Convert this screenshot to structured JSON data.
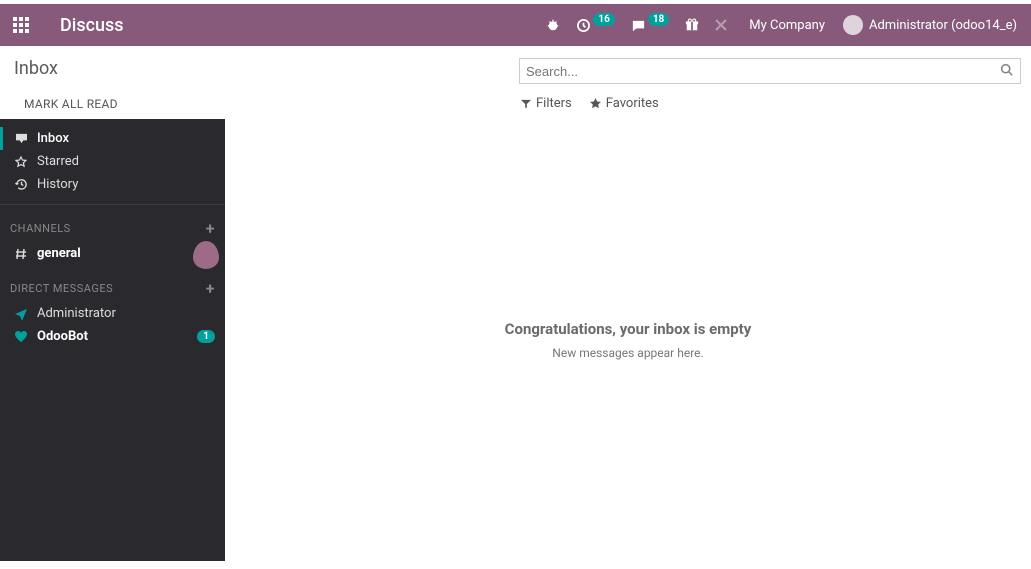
{
  "navbar": {
    "title": "Discuss",
    "badge1": "16",
    "badge2": "18",
    "company": "My Company",
    "user": "Administrator (odoo14_e)"
  },
  "control": {
    "breadcrumb": "Inbox",
    "mark_all": "MARK ALL READ",
    "search_placeholder": "Search...",
    "filters": "Filters",
    "favorites": "Favorites"
  },
  "sidebar": {
    "inbox": "Inbox",
    "starred": "Starred",
    "history": "History",
    "channels_header": "CHANNELS",
    "channel_general": "general",
    "dm_header": "DIRECT MESSAGES",
    "dm_admin": "Administrator",
    "dm_odoobot": "OdooBot",
    "odoobot_badge": "1"
  },
  "content": {
    "title": "Congratulations, your inbox is empty",
    "sub": "New messages appear here."
  }
}
